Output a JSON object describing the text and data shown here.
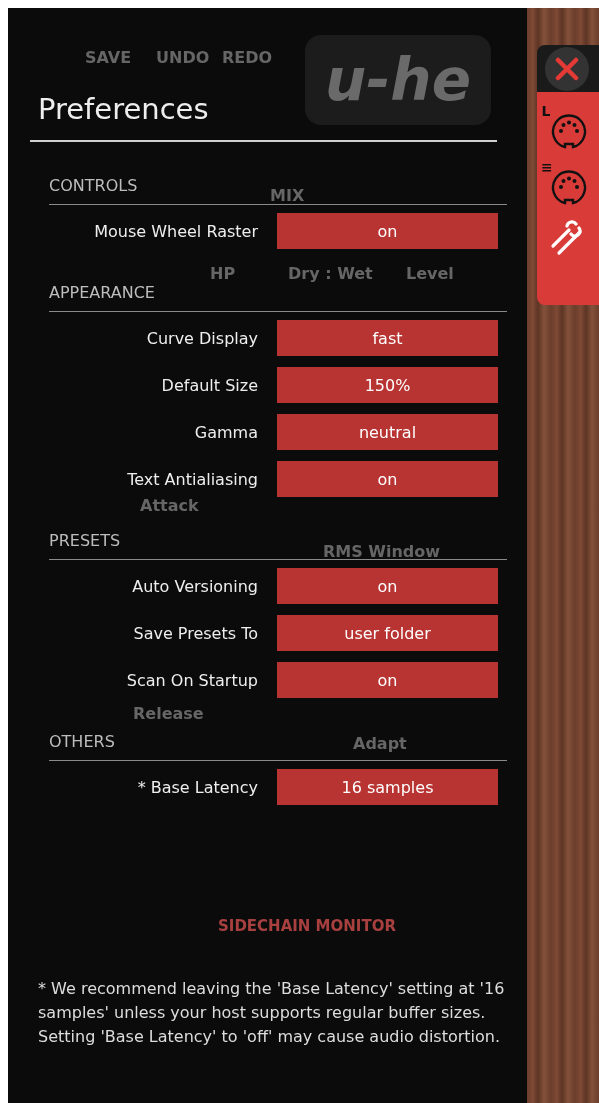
{
  "window": {
    "title": "Preferences"
  },
  "background_labels": [
    {
      "kind": "label",
      "text": "SAVE"
    },
    {
      "kind": "label",
      "text": "UNDO"
    },
    {
      "kind": "label",
      "text": "REDO"
    },
    {
      "kind": "logo",
      "text": "u-he"
    },
    {
      "kind": "label",
      "text": "MIX"
    },
    {
      "kind": "label",
      "text": "HP"
    },
    {
      "kind": "label",
      "text": "Dry : Wet"
    },
    {
      "kind": "label",
      "text": "Level"
    },
    {
      "kind": "label",
      "text": "Attack"
    },
    {
      "kind": "label",
      "text": "RMS Window"
    },
    {
      "kind": "label",
      "text": "Release"
    },
    {
      "kind": "label",
      "text": "Adapt"
    },
    {
      "kind": "heading",
      "text": "SIDECHAIN MONITOR"
    }
  ],
  "sections": [
    {
      "title": "CONTROLS",
      "rows": [
        {
          "label": "Mouse Wheel Raster",
          "value": "on"
        }
      ]
    },
    {
      "title": "APPEARANCE",
      "rows": [
        {
          "label": "Curve Display",
          "value": "fast"
        },
        {
          "label": "Default Size",
          "value": "150%"
        },
        {
          "label": "Gamma",
          "value": "neutral"
        },
        {
          "label": "Text Antialiasing",
          "value": "on"
        }
      ]
    },
    {
      "title": "PRESETS",
      "rows": [
        {
          "label": "Auto Versioning",
          "value": "on"
        },
        {
          "label": "Save Presets To",
          "value": "user folder"
        },
        {
          "label": "Scan On Startup",
          "value": "on"
        }
      ]
    },
    {
      "title": "OTHERS",
      "rows": [
        {
          "label": "* Base Latency",
          "value": "16 samples"
        }
      ]
    }
  ],
  "footnote": "* We recommend leaving the 'Base Latency' setting at '16 samples' unless your host supports regular buffer sizes. Setting 'Base Latency' to 'off' may cause audio distortion.",
  "sidebar": {
    "buttons": [
      {
        "kind": "close"
      },
      {
        "kind": "midi",
        "glyph": "L"
      },
      {
        "kind": "midi",
        "glyph": "≡"
      },
      {
        "kind": "tools"
      }
    ]
  }
}
